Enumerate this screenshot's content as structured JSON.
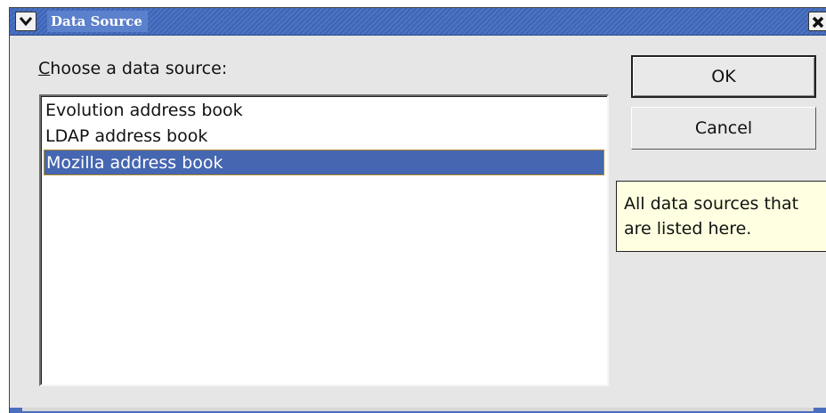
{
  "window": {
    "title": "Data Source"
  },
  "dialog": {
    "prompt_mnemonic": "C",
    "prompt_rest": "hoose a data source:",
    "items": [
      {
        "label": "Evolution address book",
        "selected": false
      },
      {
        "label": "LDAP address book",
        "selected": false
      },
      {
        "label": "Mozilla address book",
        "selected": true
      }
    ],
    "ok_label": "OK",
    "cancel_label": "Cancel",
    "tooltip_line1": "All data sources that",
    "tooltip_line2": "are listed here."
  },
  "colors": {
    "titlebar": "#4b74c5",
    "selection": "#4566b0",
    "tooltip_bg": "#ffffe1"
  }
}
